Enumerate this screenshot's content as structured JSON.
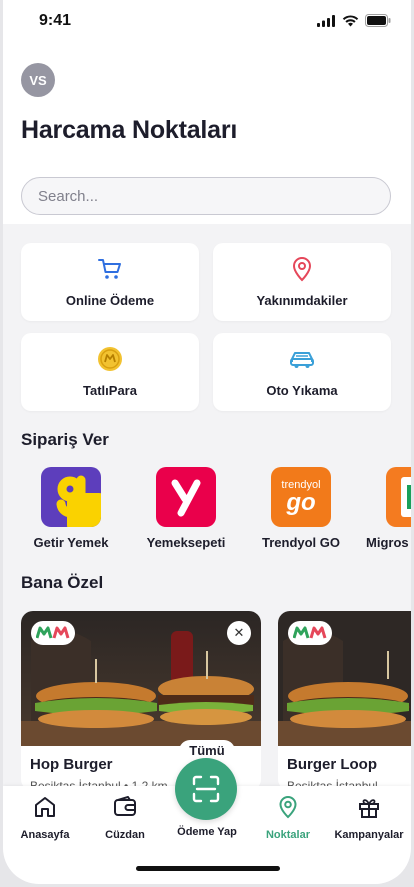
{
  "status_bar": {
    "time": "9:41"
  },
  "user": {
    "initials": "VS"
  },
  "page_title": "Harcama Noktaları",
  "search": {
    "placeholder": "Search...",
    "value": ""
  },
  "quick_actions": [
    {
      "label": "Online Ödeme",
      "icon": "cart-icon"
    },
    {
      "label": "Yakınımdakiler",
      "icon": "location-pin-icon"
    },
    {
      "label": "TatlıPara",
      "icon": "coin-icon"
    },
    {
      "label": "Oto Yıkama",
      "icon": "car-icon"
    }
  ],
  "order_section": {
    "title": "Sipariş Ver",
    "brands": [
      {
        "name": "Getir Yemek",
        "color": "#5d3ebc"
      },
      {
        "name": "Yemeksepeti",
        "color": "#ea004b"
      },
      {
        "name": "Trendyol GO",
        "color": "#f27a1a",
        "logo_text": [
          "trendyol",
          "go"
        ]
      },
      {
        "name": "Migros",
        "color": "#f47b20"
      }
    ]
  },
  "special_section": {
    "title": "Bana Özel",
    "cards": [
      {
        "name": "Hop Burger",
        "location": "Beşiktaş İstanbul • 1,2 km"
      },
      {
        "name": "Burger Loop",
        "location": "Beşiktaş İstanbul"
      }
    ],
    "see_all_label": "Tümü"
  },
  "tab_bar": {
    "items": [
      {
        "label": "Anasayfa",
        "icon": "home-icon",
        "active": false
      },
      {
        "label": "Cüzdan",
        "icon": "wallet-icon",
        "active": false
      },
      {
        "label": "Ödeme Yap",
        "icon": "scan-icon",
        "active": false
      },
      {
        "label": "Noktalar",
        "icon": "location-pin-icon",
        "active": true
      },
      {
        "label": "Kampanyalar",
        "icon": "gift-icon",
        "active": false
      }
    ]
  },
  "colors": {
    "accent": "#3aa37c",
    "title": "#1d1d2b",
    "cart_blue": "#2f6fe0",
    "pin_red": "#e5475a",
    "coin_gold": "#e7b416",
    "car_blue": "#3aa0d8"
  }
}
